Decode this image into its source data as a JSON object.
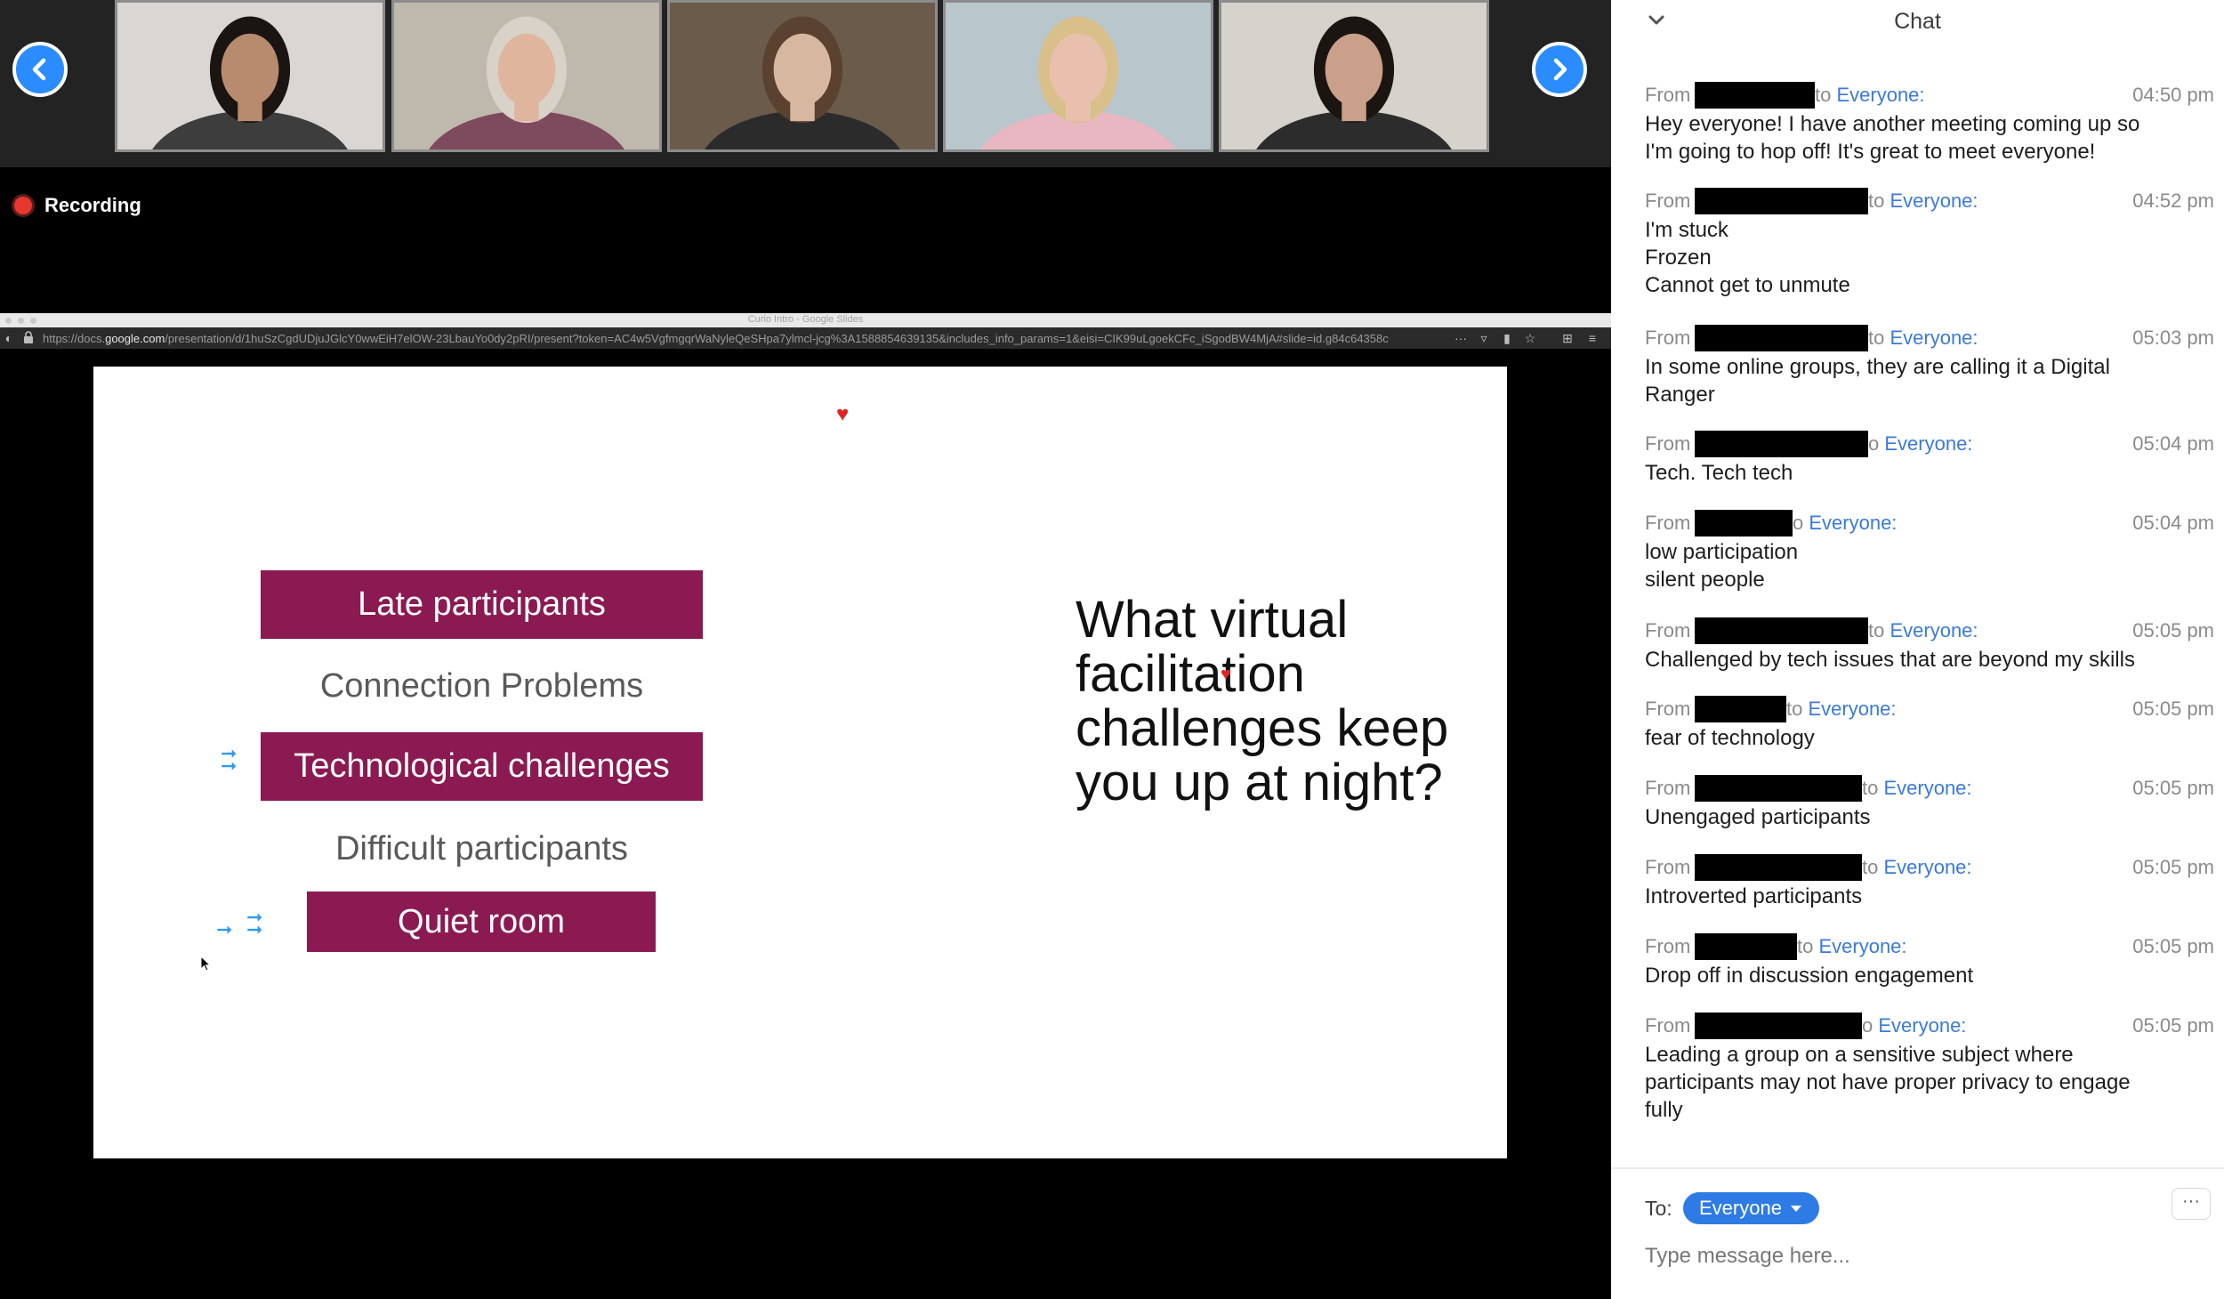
{
  "meeting": {
    "recording_label": "Recording",
    "participants": [
      {
        "name": "",
        "skin": "#b88a6e",
        "hair": "#1a1412",
        "bg": "#d9d6d4",
        "shirt": "#3d3d3d"
      },
      {
        "name": "",
        "skin": "#e0b59e",
        "hair": "#d8d2c8",
        "bg": "#bfb8ad",
        "shirt": "#7e4a5d"
      },
      {
        "name": "",
        "skin": "#d8b7a1",
        "hair": "#5a4130",
        "bg": "#6b5b4b",
        "shirt": "#2b2b2b"
      },
      {
        "name": "",
        "skin": "#e8c0ad",
        "hair": "#d9c08a",
        "bg": "#b9c7cc",
        "shirt": "#e9b7c1"
      },
      {
        "name": "",
        "skin": "#caa08a",
        "hair": "#1b1512",
        "bg": "#d6d2cc",
        "shirt": "#2c2c2c"
      }
    ]
  },
  "shared_window": {
    "window_title": "Curio Intro - Google Slides",
    "url_prefix": "https://docs.",
    "url_domain": "google.com",
    "url_path": "/presentation/d/1huSzCgdUDjuJGlcY0wwEiH7elOW-23LbauYo0dy2pRI/present?token=AC4w5VgfmgqrWaNyleQeSHpa7ylmcl-jcg%3A1588854639135&includes_info_params=1&eisi=CIK99uLgoekCFc_iSgodBW4MjA#slide=id.g84c64358c"
  },
  "slide": {
    "items": {
      "late": "Late participants",
      "connection": "Connection Problems",
      "tech": "Technological challenges",
      "difficult": "Difficult participants",
      "quiet": "Quiet room"
    },
    "question": "What virtual facilitation challenges keep you up at night?",
    "colors": {
      "box": "#8b1a52",
      "arrow": "#2d9bf0",
      "heart": "#e02424"
    }
  },
  "chat": {
    "title": "Chat",
    "messages": [
      {
        "from_label": "From",
        "to_text": "to ",
        "recipient": "Everyone:",
        "time": "04:50 pm",
        "body": "Hey everyone! I have another meeting coming up so\nI'm going to hop off! It's great to meet everyone!"
      },
      {
        "from_label": "From",
        "to_text": "to ",
        "recipient": "Everyone:",
        "time": "04:52 pm",
        "body": "I'm stuck\nFrozen\nCannot get to unmute"
      },
      {
        "from_label": "From",
        "to_text": "to ",
        "recipient": "Everyone:",
        "time": "05:03 pm",
        "body": "In some online groups, they are calling it a Digital\nRanger"
      },
      {
        "from_label": "From",
        "to_text": "o ",
        "recipient": "Everyone:",
        "time": "05:04 pm",
        "body": "Tech. Tech tech"
      },
      {
        "from_label": "From",
        "to_text": "o ",
        "recipient": "Everyone:",
        "time": "05:04 pm",
        "body": "low participation\nsilent people"
      },
      {
        "from_label": "From",
        "to_text": "to ",
        "recipient": "Everyone:",
        "time": "05:05 pm",
        "body": "Challenged by tech issues that are beyond my skills"
      },
      {
        "from_label": "From",
        "to_text": "to ",
        "recipient": "Everyone:",
        "time": "05:05 pm",
        "body": "fear of technology"
      },
      {
        "from_label": "From",
        "to_text": "to ",
        "recipient": "Everyone:",
        "time": "05:05 pm",
        "body": "Unengaged participants"
      },
      {
        "from_label": "From",
        "to_text": "to ",
        "recipient": "Everyone:",
        "time": "05:05 pm",
        "body": "Introverted participants"
      },
      {
        "from_label": "From",
        "to_text": "to ",
        "recipient": "Everyone:",
        "time": "05:05 pm",
        "body": "Drop off in discussion engagement"
      },
      {
        "from_label": "From",
        "to_text": "o ",
        "recipient": "Everyone:",
        "time": "05:05 pm",
        "body": "Leading a group on a sensitive subject where\nparticipants may not have proper privacy to engage\nfully"
      }
    ],
    "to_label": "To:",
    "recipient_select": "Everyone",
    "more_label": "···",
    "input_placeholder": "Type message here...",
    "accent": "#2f7be5"
  }
}
